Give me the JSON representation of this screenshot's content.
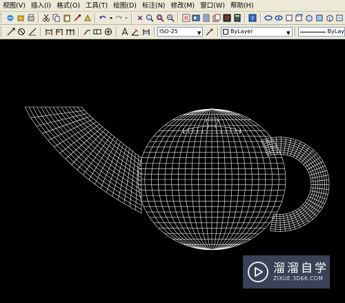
{
  "menubar": {
    "items": [
      {
        "label": "视图(V)"
      },
      {
        "label": "插入(I)"
      },
      {
        "label": "格式(O)"
      },
      {
        "label": "工具(T)"
      },
      {
        "label": "绘图(D)"
      },
      {
        "label": "标注(N)"
      },
      {
        "label": "修改(M)"
      },
      {
        "label": "窗口(W)"
      },
      {
        "label": "帮助(H)"
      }
    ]
  },
  "toolbar2": {
    "dimstyle_value": "ISO-25",
    "layer_value": "ByLayer",
    "linetype_value": "ByLay"
  },
  "viewport": {
    "background": "#000000",
    "wireframe_color": "#ffffff",
    "object": "teapot-wireframe"
  },
  "watermark": {
    "title": "溜溜自学",
    "url": "ZIXUE.3D66.COM"
  },
  "colors": {
    "chrome": "#ece9d8",
    "canvas": "#000000"
  }
}
